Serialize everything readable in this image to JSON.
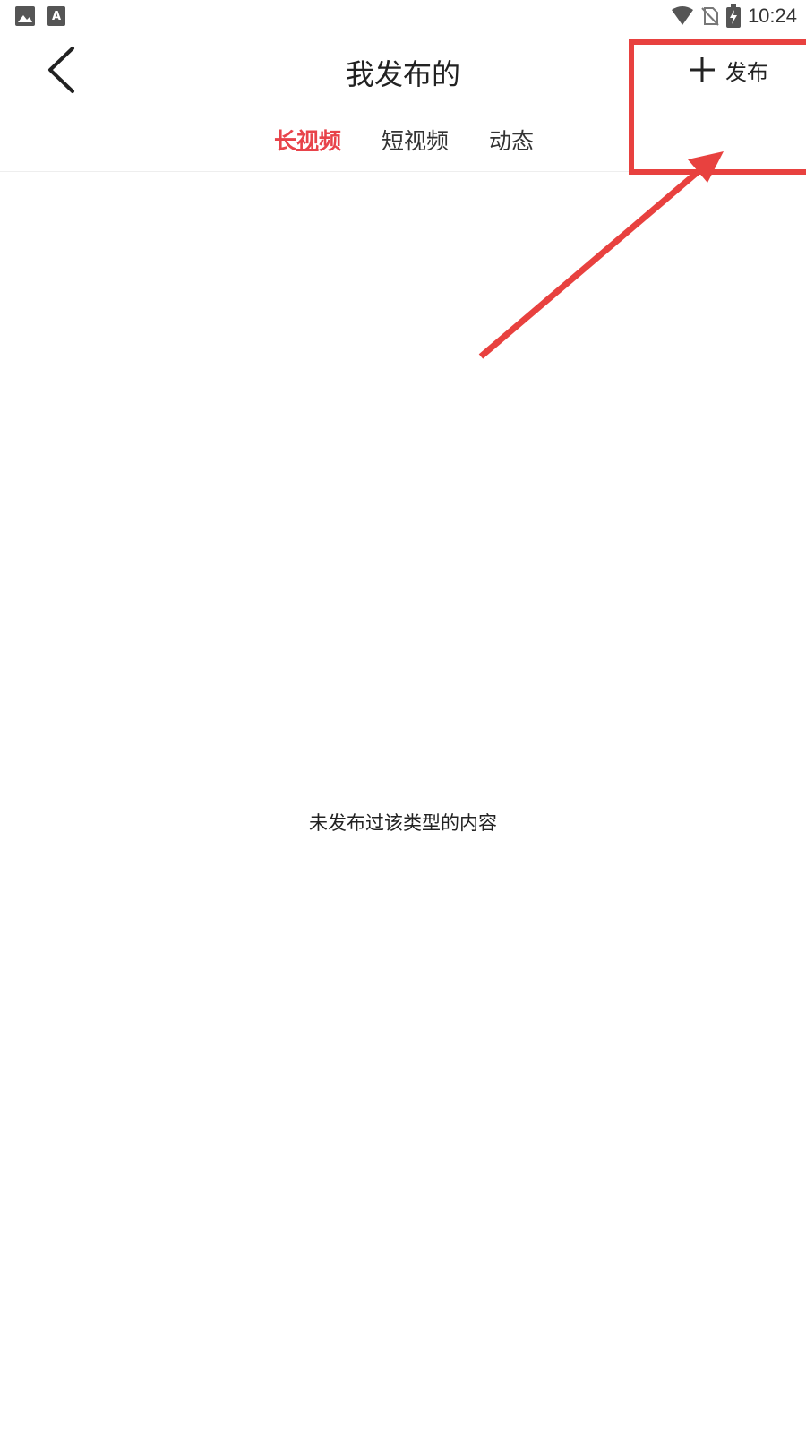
{
  "status_bar": {
    "time": "10:24",
    "left_icons": [
      "image-icon",
      "font-icon"
    ],
    "right_icons": [
      "wifi-icon",
      "no-sim-icon",
      "battery-charging-icon"
    ]
  },
  "header": {
    "title": "我发布的",
    "back_icon": "chevron-left-icon",
    "publish_label": "发布",
    "publish_icon": "plus-icon"
  },
  "tabs": [
    {
      "label": "长视频",
      "active": true
    },
    {
      "label": "短视频",
      "active": false
    },
    {
      "label": "动态",
      "active": false
    }
  ],
  "empty_state": {
    "message": "未发布过该类型的内容"
  },
  "annotation": {
    "color": "#e8413f"
  },
  "colors": {
    "accent": "#e8434a",
    "text_primary": "#222222"
  }
}
